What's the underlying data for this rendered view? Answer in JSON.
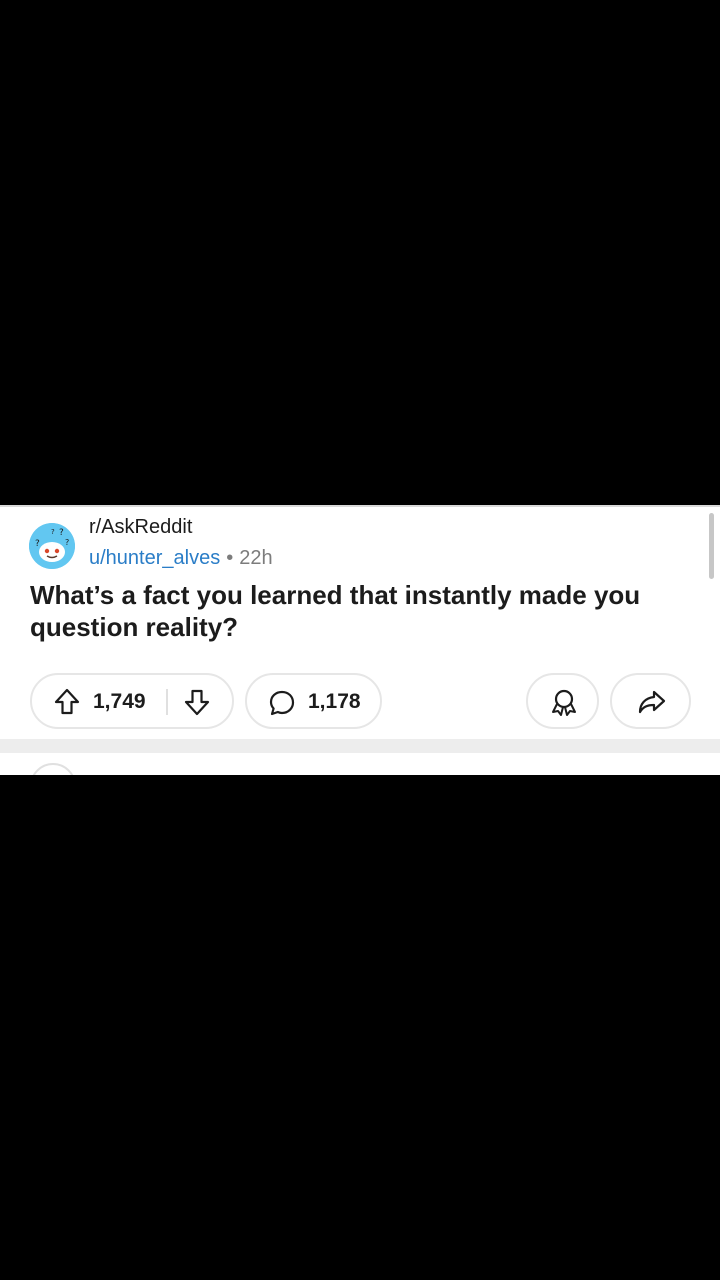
{
  "post": {
    "subreddit": "r/AskReddit",
    "author": "u/hunter_alves",
    "separator": "•",
    "age": "22h",
    "title": "What’s a fact you learned that instantly made you question reality?"
  },
  "actions": {
    "upvote_count": "1,749",
    "comment_count": "1,178"
  },
  "icons": {
    "avatar": "subreddit-avatar-icon",
    "upvote": "upvote-arrow-icon",
    "downvote": "downvote-arrow-icon",
    "comment": "comment-bubble-icon",
    "award": "award-icon",
    "share": "share-arrow-icon"
  },
  "colors": {
    "username": "#2a7dc7",
    "avatar_bg": "#62c7f1",
    "text": "#1c1c1c",
    "muted": "#7c7c7c"
  }
}
